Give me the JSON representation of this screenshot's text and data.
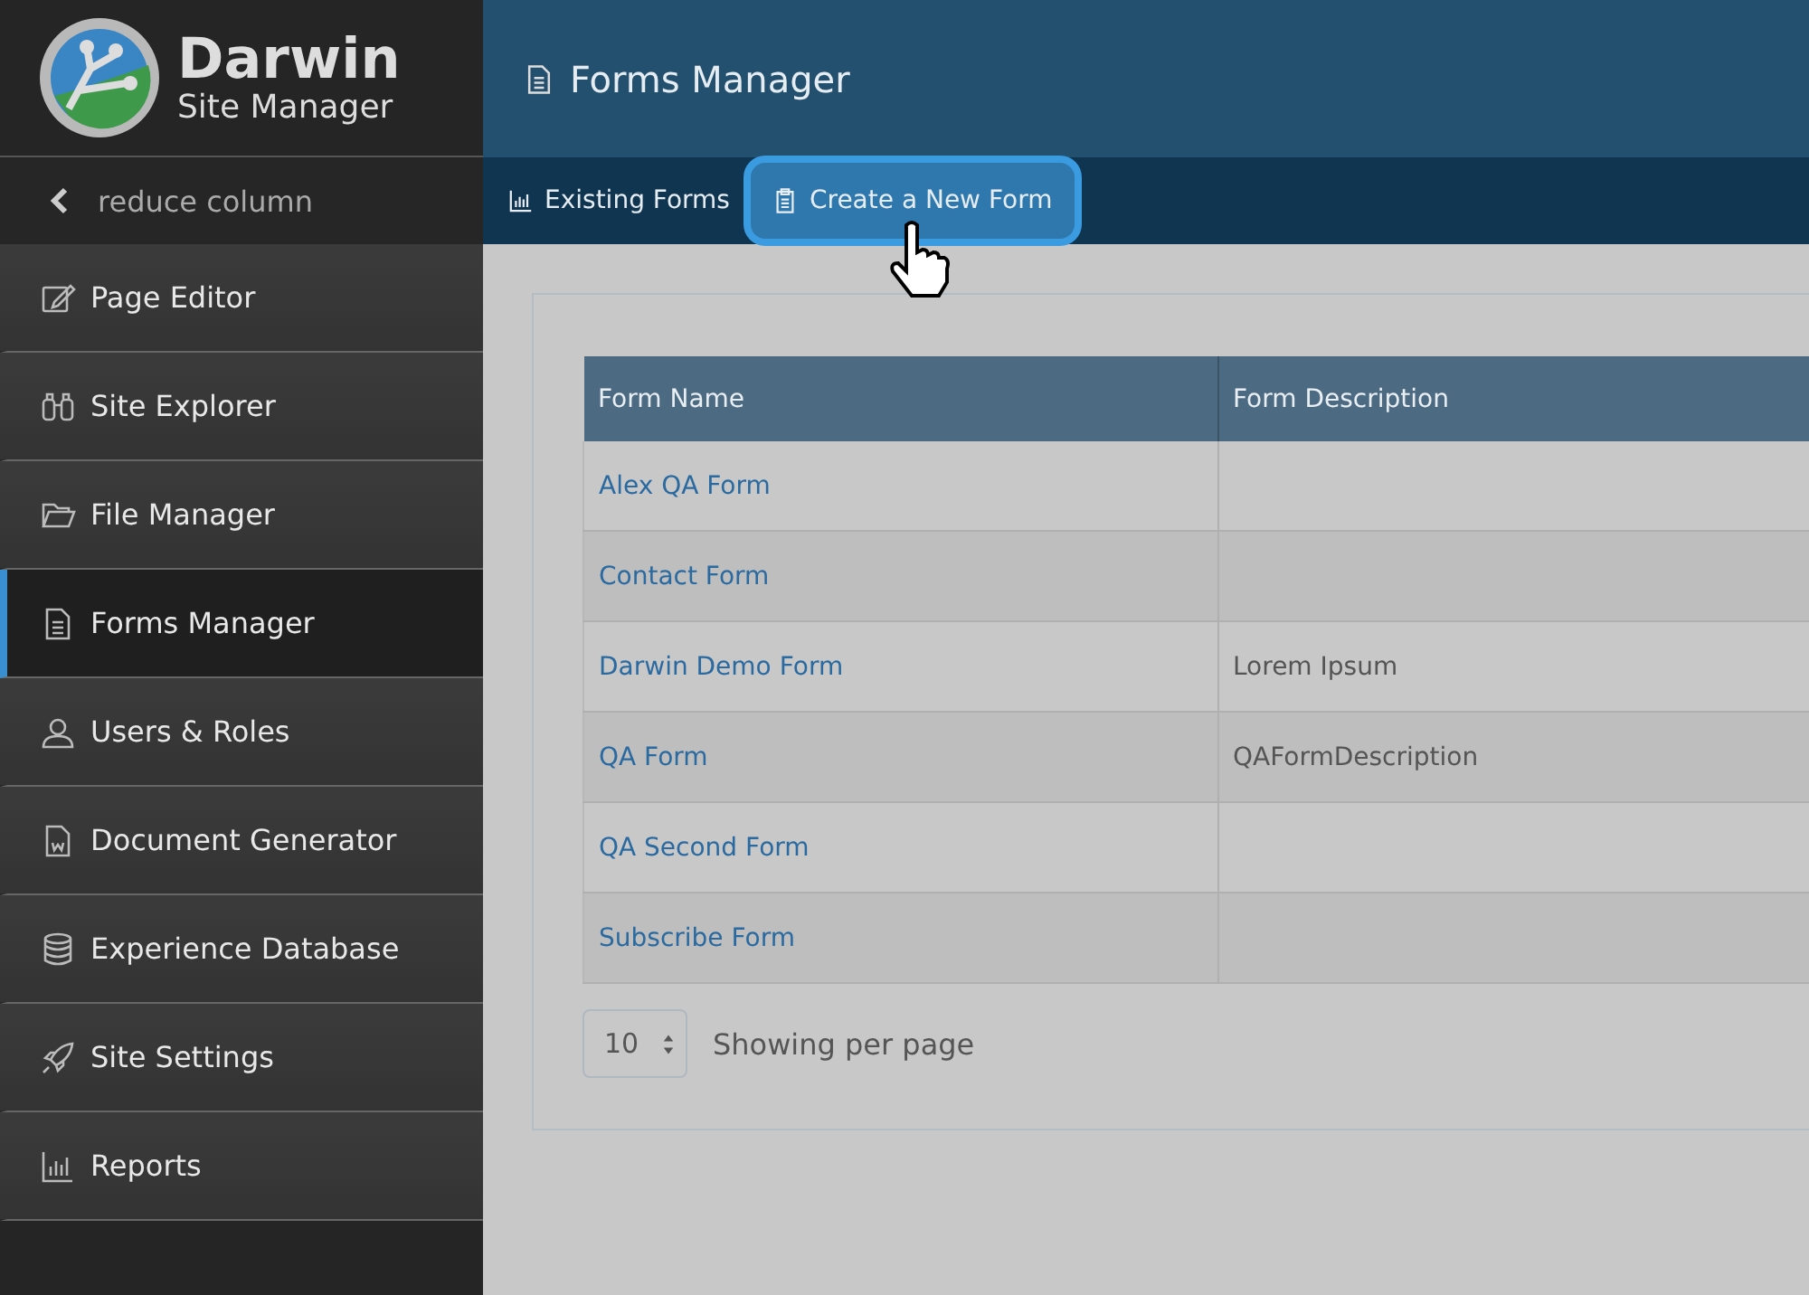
{
  "brand": {
    "name": "Darwin",
    "subtitle": "Site Manager"
  },
  "reduce_column": {
    "label": "reduce column"
  },
  "sidebar": {
    "items": [
      {
        "label": "Page Editor",
        "selected": false
      },
      {
        "label": "Site Explorer",
        "selected": false
      },
      {
        "label": "File Manager",
        "selected": false
      },
      {
        "label": "Forms Manager",
        "selected": true
      },
      {
        "label": "Users & Roles",
        "selected": false
      },
      {
        "label": "Document Generator",
        "selected": false
      },
      {
        "label": "Experience Database",
        "selected": false
      },
      {
        "label": "Site Settings",
        "selected": false
      },
      {
        "label": "Reports",
        "selected": false
      }
    ]
  },
  "header": {
    "title": "Forms Manager"
  },
  "tabs": [
    {
      "label": "Existing Forms",
      "selected": false
    },
    {
      "label": "Create a New Form",
      "selected": true
    }
  ],
  "table": {
    "columns": [
      "Form Name",
      "Form Description"
    ],
    "rows": [
      {
        "name": "Alex QA Form"
      },
      {
        "name": "Contact Form"
      },
      {
        "name": "Darwin Demo Form",
        "description": "Lorem Ipsum"
      },
      {
        "name": "QA Form",
        "description": "QAFormDescription"
      },
      {
        "name": "QA Second Form"
      },
      {
        "name": "Subscribe Form"
      }
    ]
  },
  "pagination": {
    "per_page": "10",
    "label": "Showing per page"
  }
}
